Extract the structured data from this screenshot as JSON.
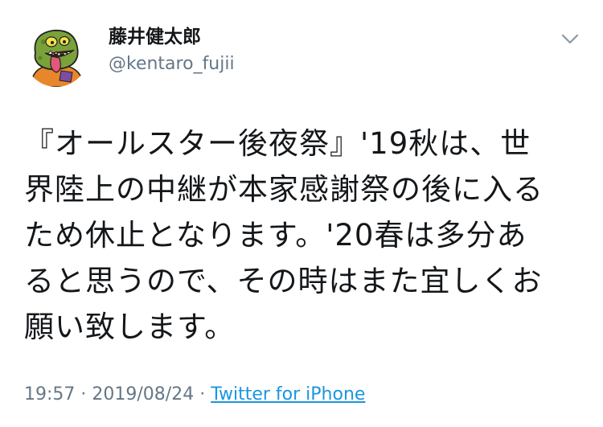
{
  "author": {
    "display_name": "藤井健太郎",
    "handle": "@kentaro_fujii",
    "avatar_icon": "green-monster-avatar-icon"
  },
  "menu": {
    "icon": "chevron-down-icon"
  },
  "tweet": {
    "lines": [
      "『オールスター後夜祭』'19秋は、世",
      "界陸上の中継が本家感謝祭の後に入る",
      "ため休止となります。'20春は多分あ",
      "ると思うので、その時はまた宜しくお",
      "願い致します。"
    ]
  },
  "meta": {
    "time": "19:57",
    "separator1": " · ",
    "date": "2019/08/24",
    "separator2": " · ",
    "source": "Twitter for iPhone"
  },
  "colors": {
    "text": "#14171a",
    "secondary": "#657786",
    "link": "#1b95e0",
    "avatar_skin": "#7aa23a"
  }
}
